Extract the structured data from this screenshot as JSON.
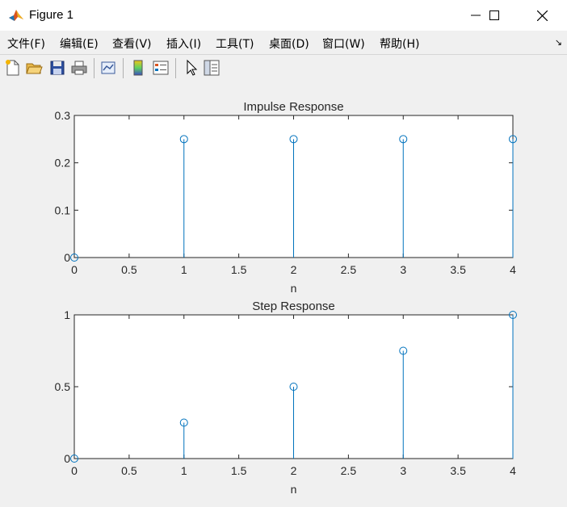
{
  "window": {
    "title": "Figure 1",
    "controls": [
      "minimize",
      "maximize",
      "close"
    ]
  },
  "menu": {
    "items": [
      "文件(F)",
      "编辑(E)",
      "查看(V)",
      "插入(I)",
      "工具(T)",
      "桌面(D)",
      "窗口(W)",
      "帮助(H)"
    ],
    "dock_arrow": "↘"
  },
  "toolbar": {
    "buttons": [
      "new-figure-icon",
      "open-file-icon",
      "save-icon",
      "print-icon",
      "link-plot-icon",
      "colorbar-icon",
      "legend-icon",
      "pointer-icon",
      "property-inspector-icon"
    ]
  },
  "colors": {
    "stem": "#0072bd",
    "axes": "#262626",
    "background": "#f0f0f0",
    "plot_bg": "#ffffff"
  },
  "chart_data": [
    {
      "type": "stem",
      "title": "Impulse Response",
      "xlabel": "n",
      "ylabel": "",
      "x": [
        0,
        1,
        2,
        3,
        4
      ],
      "y": [
        0,
        0.25,
        0.25,
        0.25,
        0.25
      ],
      "xlim": [
        0,
        4
      ],
      "ylim": [
        0,
        0.3
      ],
      "xticks": [
        "0",
        "0.5",
        "1",
        "1.5",
        "2",
        "2.5",
        "3",
        "3.5",
        "4"
      ],
      "yticks": [
        "0",
        "0.1",
        "0.2",
        "0.3"
      ],
      "grid": false
    },
    {
      "type": "stem",
      "title": "Step Response",
      "xlabel": "n",
      "ylabel": "",
      "x": [
        0,
        1,
        2,
        3,
        4
      ],
      "y": [
        0,
        0.25,
        0.5,
        0.75,
        1
      ],
      "xlim": [
        0,
        4
      ],
      "ylim": [
        0,
        1
      ],
      "xticks": [
        "0",
        "0.5",
        "1",
        "1.5",
        "2",
        "2.5",
        "3",
        "3.5",
        "4"
      ],
      "yticks": [
        "0",
        "0.5",
        "1"
      ],
      "grid": false
    }
  ]
}
